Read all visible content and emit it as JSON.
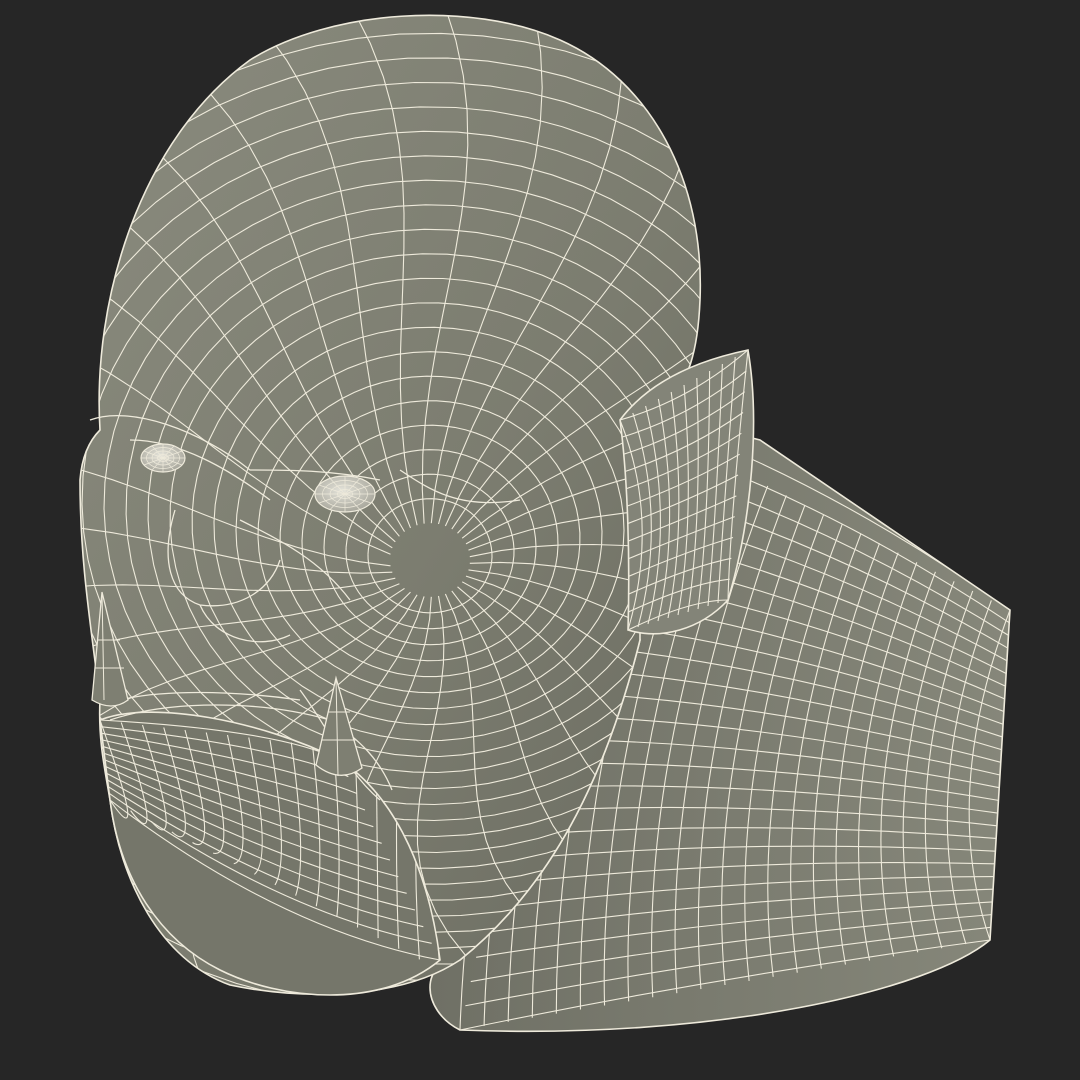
{
  "scene": {
    "subject": "orc-head-wireframe-model",
    "shading": "flat-gray-with-wireframe-overlay",
    "render_style": "quad-topology-wireframe"
  },
  "colors": {
    "background": "#262626",
    "surface": "#7c7d70",
    "surface_light": "#8e8f82",
    "surface_dark": "#66675c",
    "wire": "#eeeadb",
    "eye": "#d9d8cf"
  }
}
